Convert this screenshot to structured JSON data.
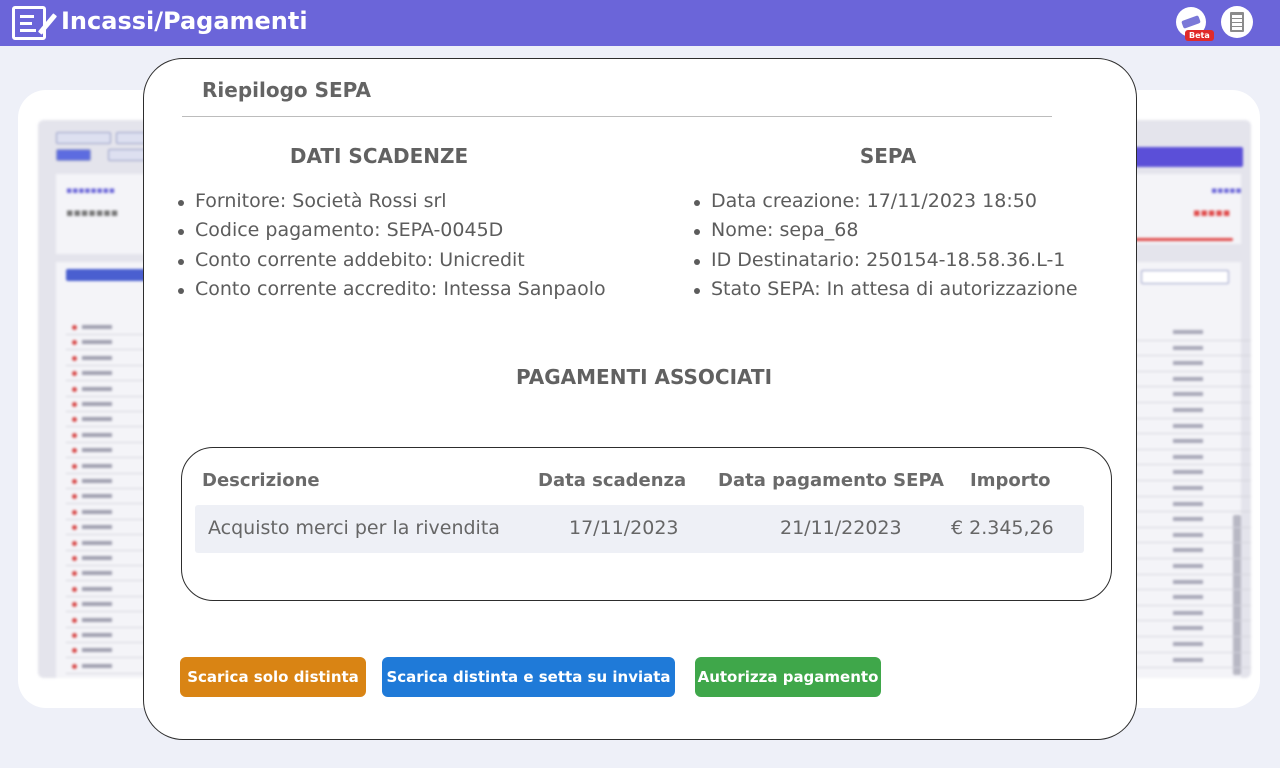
{
  "header": {
    "title": "Incassi/Pagamenti",
    "beta_badge": "Beta",
    "icons": [
      "form-edit-icon",
      "beta-feature-icon",
      "building-icon"
    ]
  },
  "modal": {
    "title": "Riepilogo SEPA",
    "dati_scadenze": {
      "title": "DATI SCADENZE",
      "items": [
        "Fornitore: Società Rossi srl",
        "Codice pagamento: SEPA-0045D",
        "Conto corrente addebito: Unicredit",
        "Conto corrente accredito: Intessa Sanpaolo"
      ]
    },
    "sepa": {
      "title": "SEPA",
      "items": [
        "Data creazione: 17/11/2023  18:50",
        "Nome: sepa_68",
        "ID Destinatario: 250154-18.58.36.L-1",
        "Stato SEPA: In attesa di autorizzazione"
      ]
    },
    "pagamenti": {
      "title": "PAGAMENTI ASSOCIATI",
      "headers": [
        "Descrizione",
        "Data scadenza",
        "Data pagamento SEPA",
        "Importo"
      ],
      "rows": [
        [
          "Acquisto merci per la rivendita",
          "17/11/2023",
          "21/11/22023",
          "€ 2.345,26"
        ]
      ]
    },
    "buttons": {
      "download_only": "Scarica solo distinta",
      "download_set_sent": "Scarica distinta e setta su inviata",
      "authorize": "Autorizza pagamento"
    },
    "colors": {
      "header": "#6b65d9",
      "download_only": "#d98414",
      "download_set_sent": "#1f7ad8",
      "authorize": "#3fa74a"
    }
  }
}
